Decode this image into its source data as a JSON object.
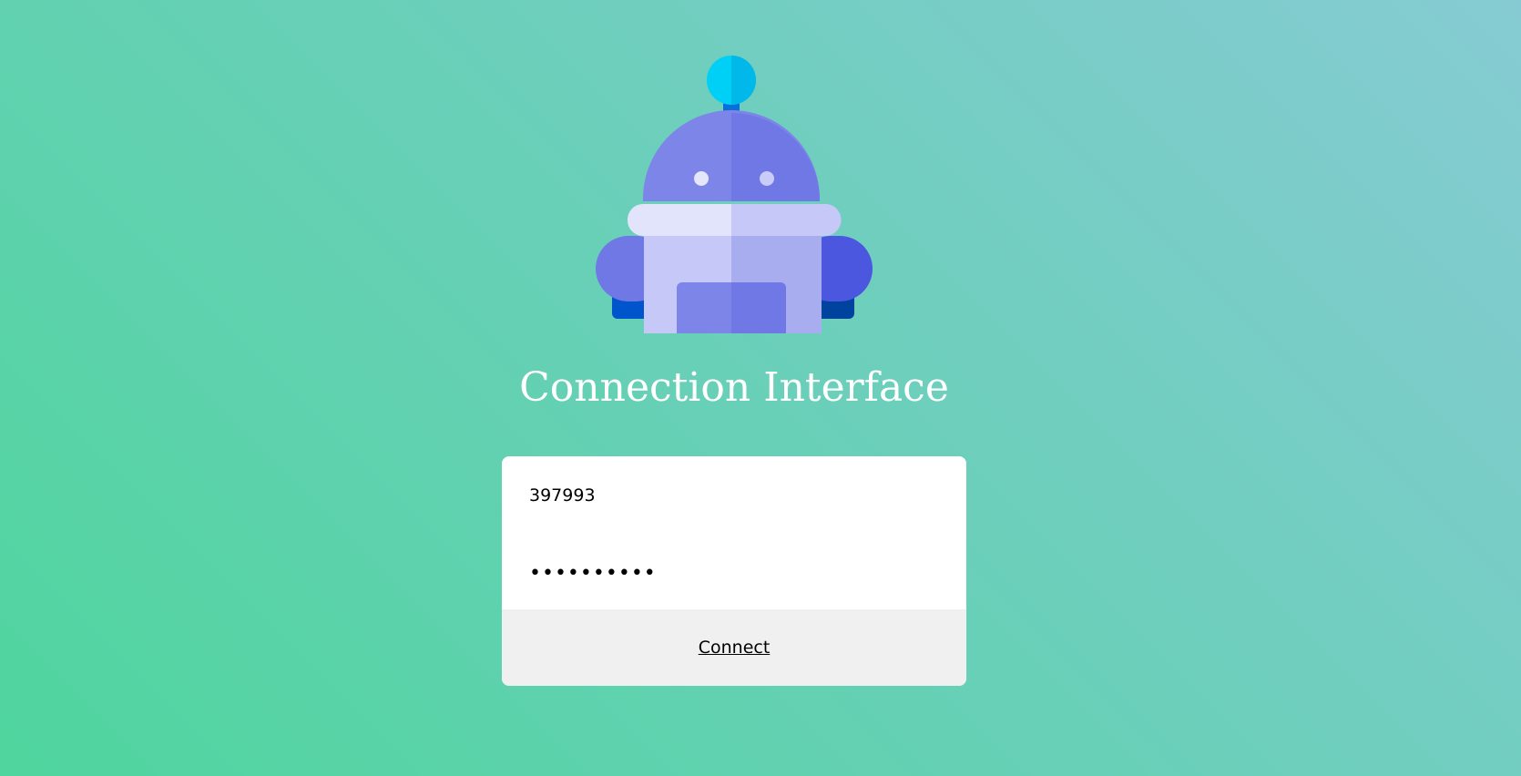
{
  "app": {
    "logo_icon": "robot-icon",
    "title": "Connection Interface"
  },
  "login_form": {
    "username_value": "397993",
    "password_value": "••••••••••",
    "connect_label": "Connect"
  },
  "colors": {
    "background_start": "#4fd59e",
    "background_end": "#86cbd3",
    "card_background": "#ffffff",
    "button_background": "#f0f0f0",
    "title_text": "#ffffff"
  }
}
